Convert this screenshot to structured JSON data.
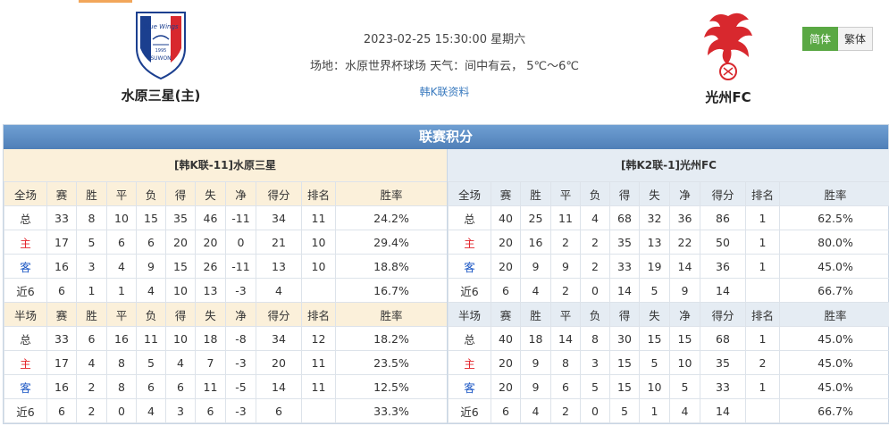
{
  "match": {
    "datetime": "2023-02-25 15:30:00 星期六",
    "venue_weather": "场地：水原世界杯球场 天气：间中有云， 5℃～6℃",
    "league_link": "韩K联资料"
  },
  "home_team": {
    "name": "水原三星(主)",
    "logo_text_top": "Blue Wings",
    "logo_text_bottom": "SUWON",
    "logo_year": "1995"
  },
  "away_team": {
    "name": "光州FC"
  },
  "lang": {
    "simplified": "简体",
    "traditional": "繁体"
  },
  "colors": {
    "accent_orange": "#f2a65a",
    "title_blue": "#5b8cc6",
    "active_green": "#5aa844",
    "home_red": "#e3242b",
    "away_blue": "#1a56c4"
  },
  "section_title": "联赛积分",
  "left": {
    "header": "[韩K联-11]水原三星",
    "full": {
      "cols": [
        "全场",
        "赛",
        "胜",
        "平",
        "负",
        "得",
        "失",
        "净",
        "得分",
        "排名",
        "胜率"
      ],
      "rows": [
        [
          "总",
          "33",
          "8",
          "10",
          "15",
          "35",
          "46",
          "-11",
          "34",
          "11",
          "24.2%"
        ],
        [
          "主",
          "17",
          "5",
          "6",
          "6",
          "20",
          "20",
          "0",
          "21",
          "10",
          "29.4%"
        ],
        [
          "客",
          "16",
          "3",
          "4",
          "9",
          "15",
          "26",
          "-11",
          "13",
          "10",
          "18.8%"
        ],
        [
          "近6",
          "6",
          "1",
          "1",
          "4",
          "10",
          "13",
          "-3",
          "4",
          "",
          "16.7%"
        ]
      ]
    },
    "half": {
      "cols": [
        "半场",
        "赛",
        "胜",
        "平",
        "负",
        "得",
        "失",
        "净",
        "得分",
        "排名",
        "胜率"
      ],
      "rows": [
        [
          "总",
          "33",
          "6",
          "16",
          "11",
          "10",
          "18",
          "-8",
          "34",
          "12",
          "18.2%"
        ],
        [
          "主",
          "17",
          "4",
          "8",
          "5",
          "4",
          "7",
          "-3",
          "20",
          "11",
          "23.5%"
        ],
        [
          "客",
          "16",
          "2",
          "8",
          "6",
          "6",
          "11",
          "-5",
          "14",
          "11",
          "12.5%"
        ],
        [
          "近6",
          "6",
          "2",
          "0",
          "4",
          "3",
          "6",
          "-3",
          "6",
          "",
          "33.3%"
        ]
      ]
    }
  },
  "right": {
    "header": "[韩K2联-1]光州FC",
    "full": {
      "cols": [
        "全场",
        "赛",
        "胜",
        "平",
        "负",
        "得",
        "失",
        "净",
        "得分",
        "排名",
        "胜率"
      ],
      "rows": [
        [
          "总",
          "40",
          "25",
          "11",
          "4",
          "68",
          "32",
          "36",
          "86",
          "1",
          "62.5%"
        ],
        [
          "主",
          "20",
          "16",
          "2",
          "2",
          "35",
          "13",
          "22",
          "50",
          "1",
          "80.0%"
        ],
        [
          "客",
          "20",
          "9",
          "9",
          "2",
          "33",
          "19",
          "14",
          "36",
          "1",
          "45.0%"
        ],
        [
          "近6",
          "6",
          "4",
          "2",
          "0",
          "14",
          "5",
          "9",
          "14",
          "",
          "66.7%"
        ]
      ]
    },
    "half": {
      "cols": [
        "半场",
        "赛",
        "胜",
        "平",
        "负",
        "得",
        "失",
        "净",
        "得分",
        "排名",
        "胜率"
      ],
      "rows": [
        [
          "总",
          "40",
          "18",
          "14",
          "8",
          "30",
          "15",
          "15",
          "68",
          "1",
          "45.0%"
        ],
        [
          "主",
          "20",
          "9",
          "8",
          "3",
          "15",
          "5",
          "10",
          "35",
          "2",
          "45.0%"
        ],
        [
          "客",
          "20",
          "9",
          "6",
          "5",
          "15",
          "10",
          "5",
          "33",
          "1",
          "45.0%"
        ],
        [
          "近6",
          "6",
          "4",
          "2",
          "0",
          "5",
          "1",
          "4",
          "14",
          "",
          "66.7%"
        ]
      ]
    }
  }
}
